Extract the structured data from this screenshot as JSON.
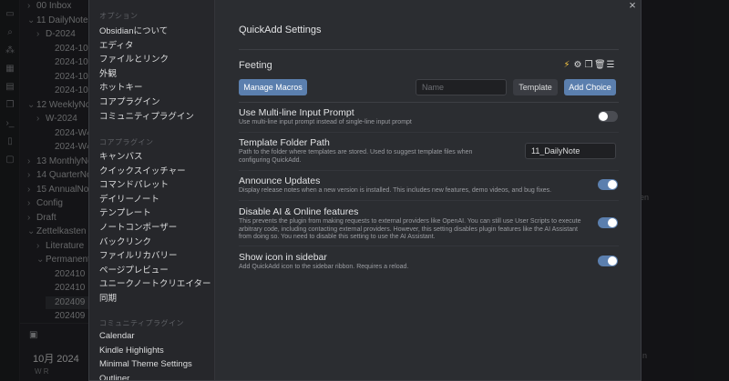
{
  "filetree": {
    "items": [
      {
        "label": "00 Inbox",
        "indent": 0,
        "arrow": "›"
      },
      {
        "label": "11 DailyNote",
        "indent": 0,
        "arrow": "⌄"
      },
      {
        "label": "D-2024",
        "indent": 1,
        "arrow": "›"
      },
      {
        "label": "2024-10-",
        "indent": 2,
        "arrow": ""
      },
      {
        "label": "2024-10-",
        "indent": 2,
        "arrow": ""
      },
      {
        "label": "2024-10-",
        "indent": 2,
        "arrow": ""
      },
      {
        "label": "2024-10-",
        "indent": 2,
        "arrow": ""
      },
      {
        "label": "12 WeeklyNo",
        "indent": 0,
        "arrow": "⌄"
      },
      {
        "label": "W-2024",
        "indent": 1,
        "arrow": "›"
      },
      {
        "label": "2024-W42",
        "indent": 2,
        "arrow": ""
      },
      {
        "label": "2024-W4",
        "indent": 2,
        "arrow": ""
      },
      {
        "label": "13 MonthlyNo",
        "indent": 0,
        "arrow": "›"
      },
      {
        "label": "14 QuarterNo",
        "indent": 0,
        "arrow": "›"
      },
      {
        "label": "15 AnnualNo",
        "indent": 0,
        "arrow": "›"
      },
      {
        "label": "Config",
        "indent": 0,
        "arrow": "›"
      },
      {
        "label": "Draft",
        "indent": 0,
        "arrow": "›"
      },
      {
        "label": "Zettelkasten",
        "indent": 0,
        "arrow": "⌄"
      },
      {
        "label": "Literature",
        "indent": 1,
        "arrow": "›"
      },
      {
        "label": "Permanent",
        "indent": 1,
        "arrow": "⌄"
      },
      {
        "label": "202410",
        "indent": 2,
        "arrow": ""
      },
      {
        "label": "202410",
        "indent": 2,
        "arrow": ""
      },
      {
        "label": "202409",
        "indent": 2,
        "arrow": "",
        "selected": true
      },
      {
        "label": "202409",
        "indent": 2,
        "arrow": ""
      },
      {
        "label": "202409",
        "indent": 2,
        "arrow": ""
      }
    ]
  },
  "calendar": {
    "month": "10月 2024",
    "weekdays": "W  R"
  },
  "settings_sidebar": {
    "core_heading": "オプション",
    "core_items": [
      "Obsidianについて",
      "エディタ",
      "ファイルとリンク",
      "外観",
      "ホットキー",
      "コアプラグイン",
      "コミュニティプラグイン"
    ],
    "plugins_heading": "コアプラグイン",
    "plugin_items": [
      "キャンバス",
      "クイックスイッチャー",
      "コマンドパレット",
      "デイリーノート",
      "テンプレート",
      "ノートコンポーザー",
      "バックリンク",
      "ファイルリカバリー",
      "ページプレビュー",
      "ユニークノートクリエイター",
      "同期"
    ],
    "community_heading": "コミュニティプラグイン",
    "community_items": [
      "Calendar",
      "Kindle Highlights",
      "Minimal Theme Settings",
      "Outliner"
    ]
  },
  "settings_page": {
    "title": "QuickAdd Settings",
    "close_icon": "×",
    "choice": {
      "name": "Feeting",
      "icons": [
        "bolt-icon",
        "gear-icon",
        "duplicate-icon",
        "trash-icon",
        "drag-handle-icon"
      ]
    },
    "manage_macros_label": "Manage Macros",
    "name_placeholder": "Name",
    "template_label": "Template",
    "add_choice_label": "Add Choice",
    "settings": [
      {
        "name": "Use Multi-line Input Prompt",
        "desc": "Use multi-line input prompt instead of single-line input prompt",
        "toggle": false
      },
      {
        "name": "Template Folder Path",
        "desc": "Path to the folder where templates are stored. Used to suggest template files when configuring QuickAdd.",
        "input_value": "11_DailyNote"
      },
      {
        "name": "Announce Updates",
        "desc": "Display release notes when a new version is installed. This includes new features, demo videos, and bug fixes.",
        "toggle": true
      },
      {
        "name": "Disable AI & Online features",
        "desc": "This prevents the plugin from making requests to external providers like OpenAI. You can still use User Scripts to execute arbitrary code, including contacting external providers. However, this setting disables plugin features like the AI Assistant from doing so. You need to disable this setting to use the AI Assistant.",
        "toggle": true
      },
      {
        "name": "Show icon in sidebar",
        "desc": "Add QuickAdd icon to the sidebar ribbon. Requires a reload.",
        "toggle": true
      }
    ]
  },
  "background_text": {
    "fragment_right": "en",
    "fragment_bottom": "n"
  },
  "colors": {
    "accent": "#5b7fae",
    "modal_bg": "#2b2d31",
    "sidebar_bg": "#26272b",
    "bolt": "#f5c542"
  }
}
